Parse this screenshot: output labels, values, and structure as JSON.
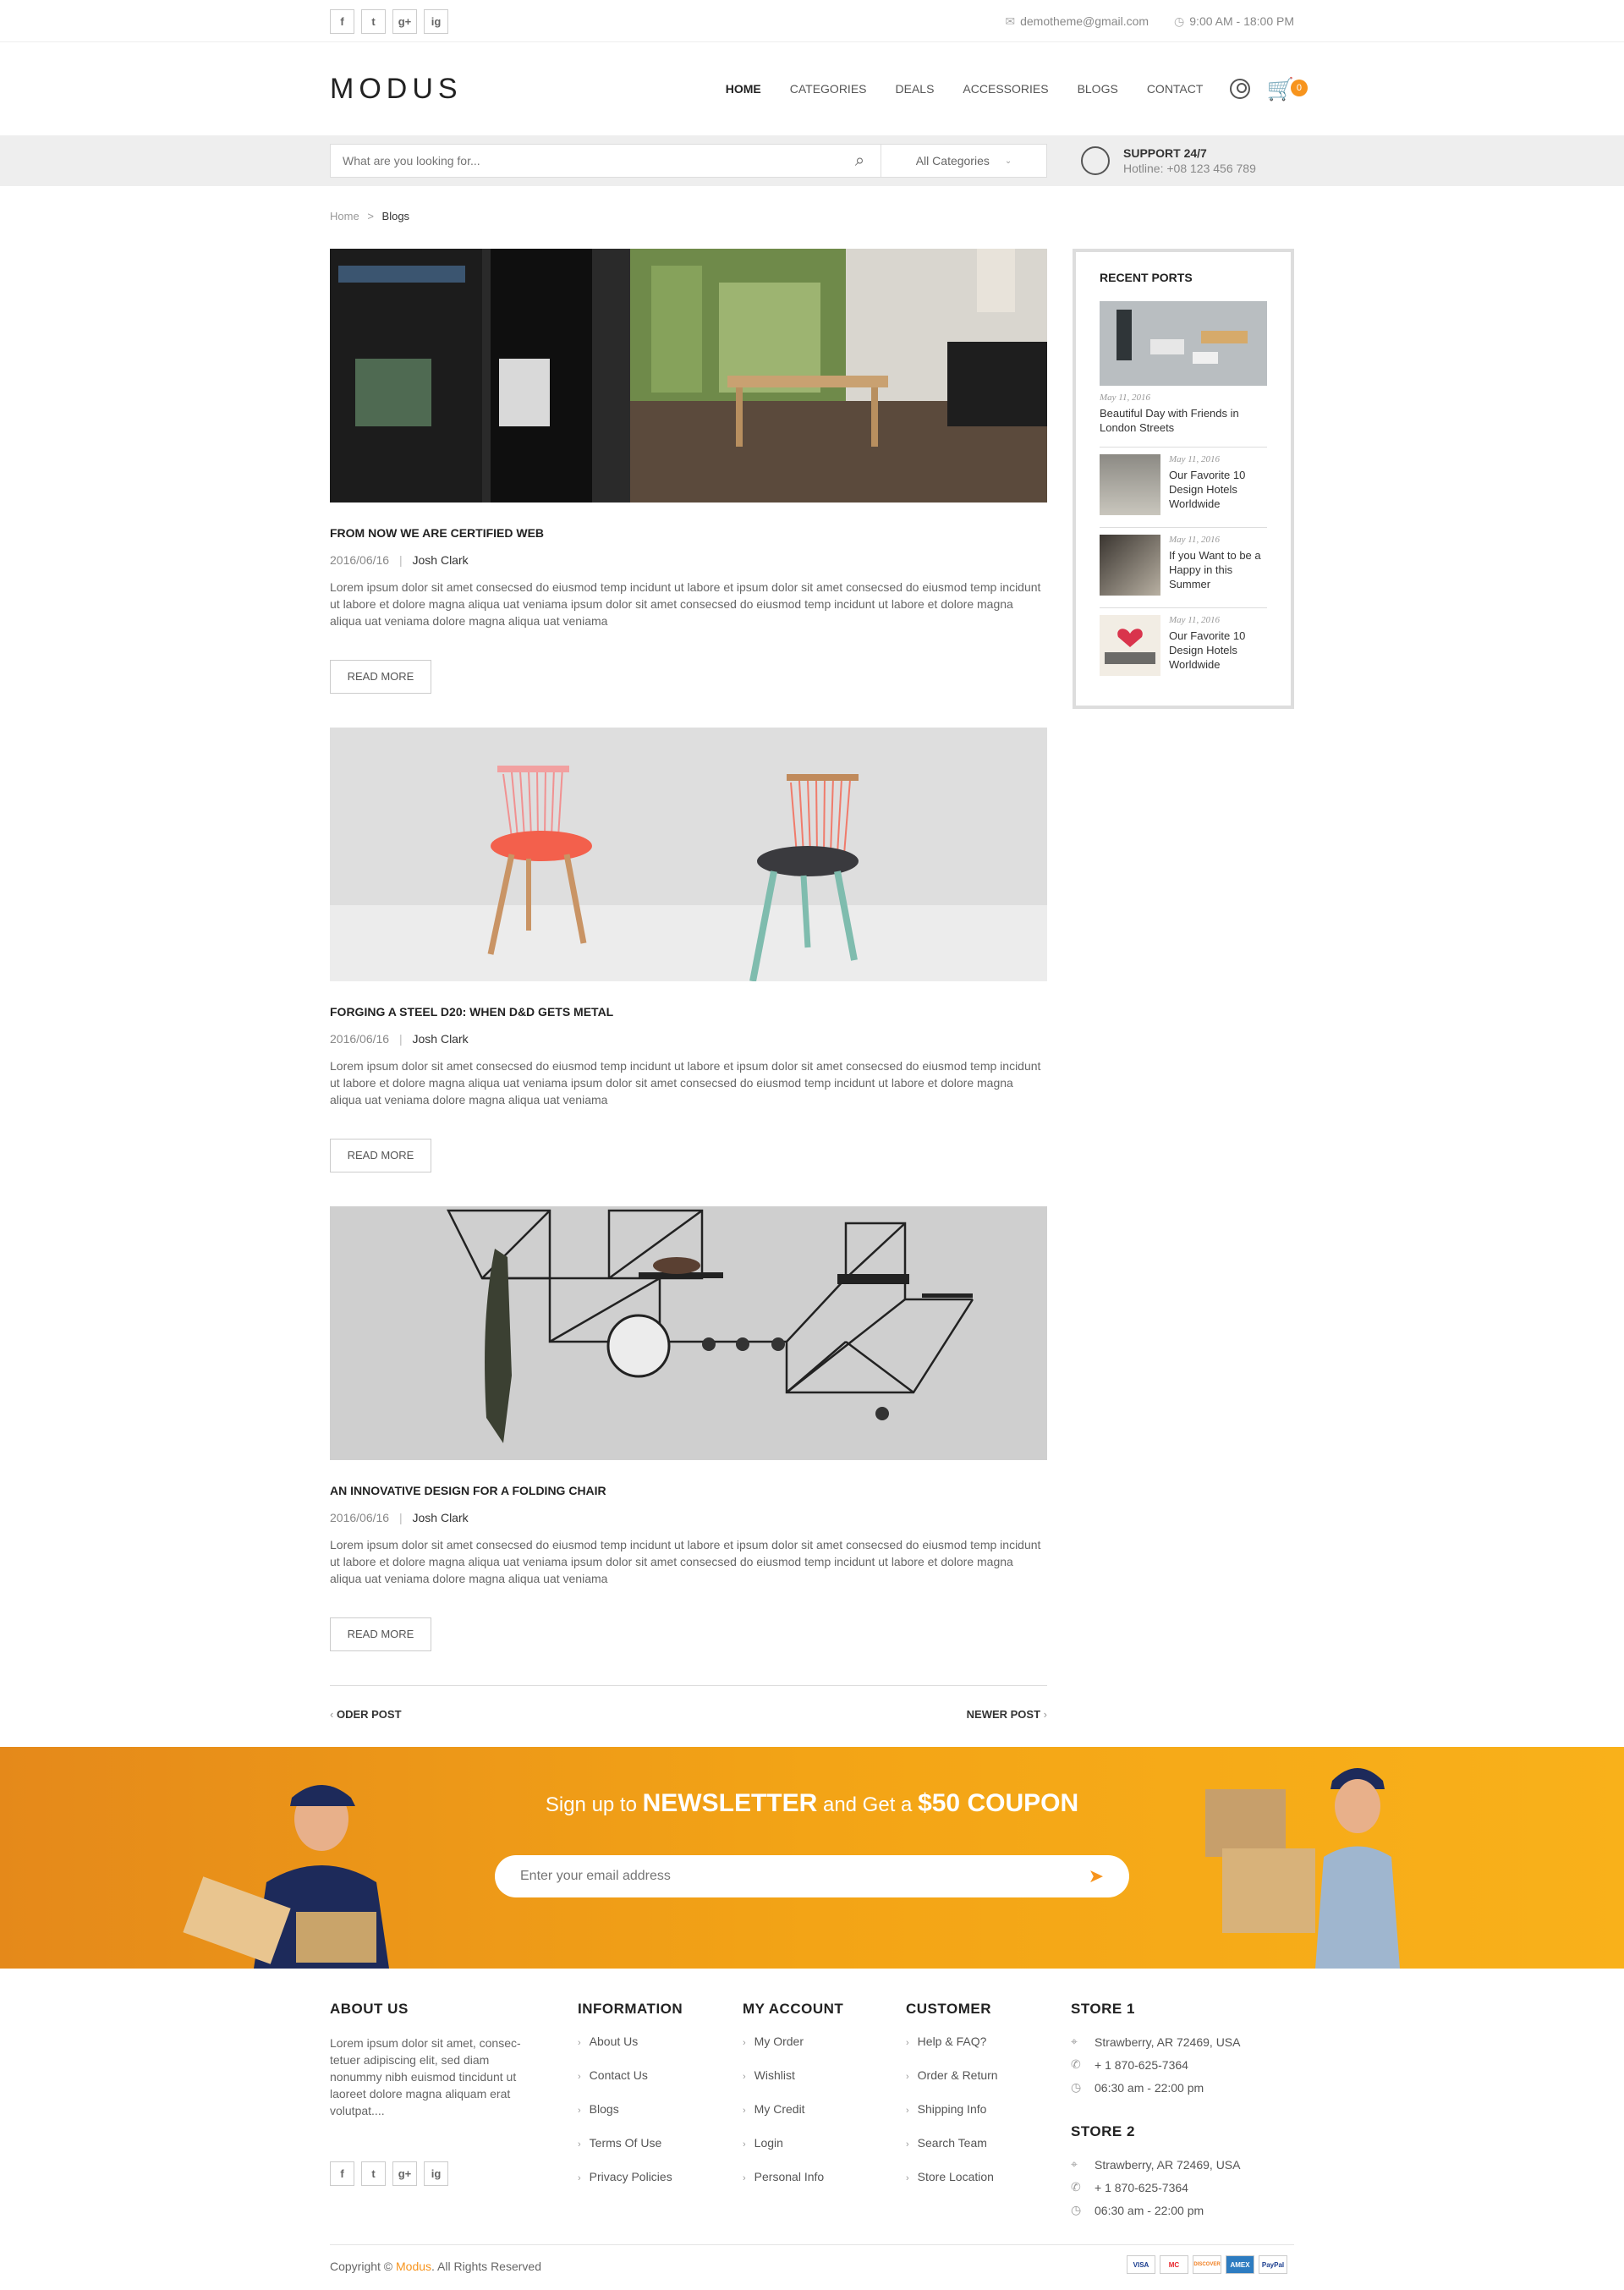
{
  "topbar": {
    "email": "demotheme@gmail.com",
    "hours": "9:00 AM - 18:00 PM",
    "socials": [
      "f",
      "t",
      "g+",
      "ig"
    ]
  },
  "header": {
    "logo": "MODUS",
    "nav": [
      "HOME",
      "CATEGORIES",
      "DEALS",
      "ACCESSORIES",
      "BLOGS",
      "CONTACT"
    ],
    "cart_count": "0"
  },
  "search": {
    "placeholder": "What are you looking for...",
    "category": "All Categories",
    "support_title": "SUPPORT 24/7",
    "support_hotline": "Hotline: +08 123 456 789"
  },
  "breadcrumb": {
    "home": "Home",
    "sep": ">",
    "current": "Blogs"
  },
  "posts": [
    {
      "title": "FROM NOW WE ARE CERTIFIED WEB",
      "date": "2016/06/16",
      "author": "Josh Clark",
      "text": "Lorem ipsum dolor sit amet consecsed do eiusmod temp incidunt ut labore et ipsum dolor sit amet consecsed do eiusmod temp incidunt ut labore et dolore magna aliqua uat veniama ipsum dolor sit amet consecsed do eiusmod temp incidunt ut labore et dolore magna aliqua uat veniama dolore magna aliqua uat veniama",
      "button": "READ MORE"
    },
    {
      "title": "FORGING A STEEL D20: WHEN D&D GETS METAL",
      "date": "2016/06/16",
      "author": "Josh Clark",
      "text": "Lorem ipsum dolor sit amet consecsed do eiusmod temp incidunt ut labore et ipsum dolor sit amet consecsed do eiusmod temp incidunt ut labore et dolore magna aliqua uat veniama ipsum dolor sit amet consecsed do eiusmod temp incidunt ut labore et dolore magna aliqua uat veniama dolore magna aliqua uat veniama",
      "button": "READ MORE"
    },
    {
      "title": "AN INNOVATIVE DESIGN FOR A FOLDING CHAIR",
      "date": "2016/06/16",
      "author": "Josh Clark",
      "text": "Lorem ipsum dolor sit amet consecsed do eiusmod temp incidunt ut labore et ipsum dolor sit amet consecsed do eiusmod temp incidunt ut labore et dolore magna aliqua uat veniama ipsum dolor sit amet consecsed do eiusmod temp incidunt ut labore et dolore magna aliqua uat veniama dolore magna aliqua uat veniama",
      "button": "READ MORE"
    }
  ],
  "pager": {
    "older": "ODER POST",
    "newer": "NEWER POST"
  },
  "sidebar": {
    "title": "RECENT PORTS",
    "featured": {
      "date": "May 11, 2016",
      "title": "Beautiful Day with Friends in London Streets"
    },
    "items": [
      {
        "date": "May 11, 2016",
        "title": "Our Favorite 10 Design Hotels Worldwide"
      },
      {
        "date": "May 11, 2016",
        "title": "If you Want to be a Happy in this Summer"
      },
      {
        "date": "May 11, 2016",
        "title": "Our Favorite 10 Design Hotels Worldwide"
      }
    ]
  },
  "newsletter": {
    "pre": "Sign up to",
    "bold1": "NEWSLETTER",
    "mid": "and Get a",
    "bold2": "$50 COUPON",
    "placeholder": "Enter your email address"
  },
  "footer": {
    "about_title": "ABOUT US",
    "about_text": "Lorem ipsum dolor sit amet, consec- tetuer adipiscing elit, sed diam nonummy nibh euismod tincidunt ut laoreet dolore magna aliquam erat volutpat....",
    "info_title": "INFORMATION",
    "info_links": [
      "About Us",
      "Contact Us",
      "Blogs",
      "Terms Of Use",
      "Privacy Policies"
    ],
    "account_title": "MY ACCOUNT",
    "account_links": [
      "My Order",
      "Wishlist",
      "My Credit",
      "Login",
      "Personal Info"
    ],
    "customer_title": "CUSTOMER",
    "customer_links": [
      "Help & FAQ?",
      "Order & Return",
      "Shipping Info",
      "Search Team",
      "Store Location"
    ],
    "store1_title": "STORE 1",
    "store1": [
      "Strawberry, AR 72469, USA",
      "+ 1 870-625-7364",
      "06:30 am - 22:00 pm"
    ],
    "store2_title": "STORE 2",
    "store2": [
      "Strawberry, AR 72469, USA",
      "+ 1 870-625-7364",
      "06:30 am - 22:00 pm"
    ],
    "copyright_pre": "Copyright ©",
    "copyright_brand": "Modus",
    "copyright_post": ". All Rights Reserved",
    "payments": [
      "VISA",
      "MC",
      "DISCOVER",
      "AMEX",
      "PayPal"
    ]
  },
  "colors": {
    "accent": "#f7941d",
    "newsletter_start": "#e5891a",
    "newsletter_end": "#f9b11a"
  }
}
